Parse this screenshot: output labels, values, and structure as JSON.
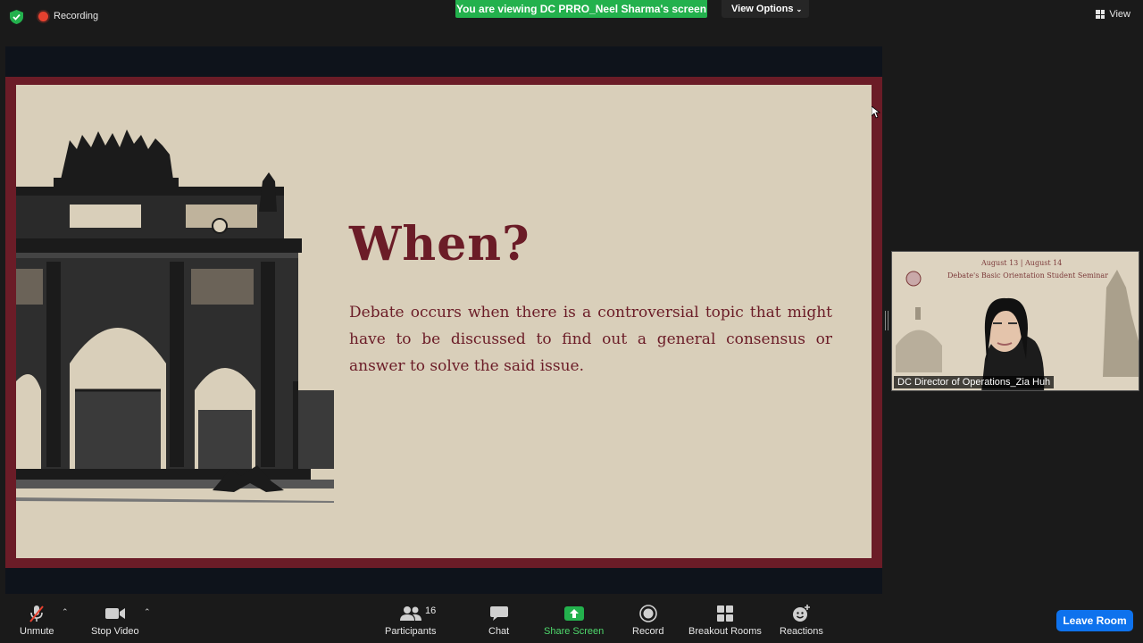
{
  "topbar": {
    "recording_label": "Recording",
    "viewing_banner": "You are viewing DC PRRO_Neel Sharma's screen",
    "view_options_label": "View Options",
    "view_label": "View"
  },
  "slide": {
    "title": "When?",
    "body": "Debate occurs when there is a controversial topic that might have to be discussed to find out a general consensus or answer to solve the said issue."
  },
  "video": {
    "participant_name": "DC Director of Operations_Zia Huh",
    "slide_line1": "August 13 | August 14",
    "slide_line2": "Debate's Basic Orientation Student Seminar"
  },
  "toolbar": {
    "unmute": "Unmute",
    "stop_video": "Stop Video",
    "participants": "Participants",
    "participants_count": "16",
    "chat": "Chat",
    "share_screen": "Share Screen",
    "record": "Record",
    "breakout_rooms": "Breakout Rooms",
    "reactions": "Reactions",
    "leave_room": "Leave Room"
  },
  "colors": {
    "banner_green": "#23b14d",
    "slide_maroon": "#6b1c27",
    "slide_beige": "#d9cfba",
    "leave_blue": "#0e72ed"
  }
}
